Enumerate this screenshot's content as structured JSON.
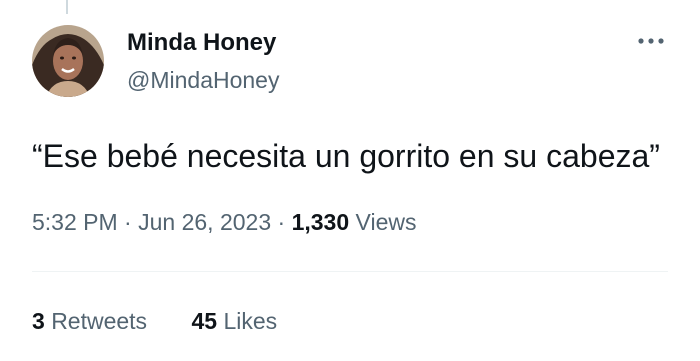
{
  "author": {
    "name": "Minda Honey",
    "handle": "@MindaHoney"
  },
  "tweet": {
    "text": "“Ese bebé necesita un gorrito en su cabeza”",
    "time": "5:32 PM",
    "separator": "·",
    "date": "Jun 26, 2023",
    "views_count": "1,330",
    "views_label": "Views"
  },
  "stats": {
    "retweets_count": "3",
    "retweets_label": "Retweets",
    "likes_count": "45",
    "likes_label": "Likes"
  },
  "icons": {
    "more": "more-dots-icon"
  },
  "colors": {
    "primary_text": "#0f1419",
    "secondary_text": "#536471",
    "divider": "#eff3f4"
  }
}
